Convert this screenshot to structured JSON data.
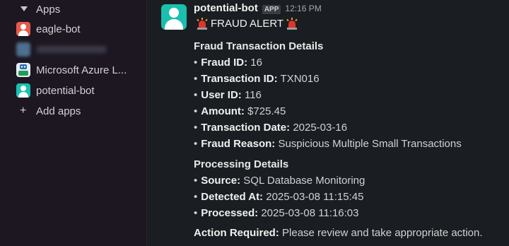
{
  "sidebar": {
    "section_label": "Apps",
    "items": [
      {
        "label": "eagle-bot",
        "avatar": "person-icon",
        "color": "#e8584a"
      },
      {
        "label": "",
        "avatar": "blurred-avatar",
        "color": "#4e6f8f"
      },
      {
        "label": "Microsoft Azure L...",
        "avatar": "azure-bot-icon",
        "color": "#e7eef7"
      },
      {
        "label": "potential-bot",
        "avatar": "person-icon",
        "color": "#18c1b0"
      }
    ],
    "add_label": "Add apps"
  },
  "message": {
    "author": "potential-bot",
    "badge": "APP",
    "time": "12:16 PM",
    "alert_icon": "rotating-light-icon",
    "alert_title": "FRAUD ALERT",
    "section1_title": "Fraud Transaction Details",
    "details": [
      {
        "key": "Fraud ID:",
        "value": "16"
      },
      {
        "key": "Transaction ID:",
        "value": "TXN016"
      },
      {
        "key": "User ID:",
        "value": "116"
      },
      {
        "key": "Amount:",
        "value": "$725.45"
      },
      {
        "key": "Transaction Date:",
        "value": "2025-03-16"
      },
      {
        "key": "Fraud Reason:",
        "value": "Suspicious Multiple Small Transactions"
      }
    ],
    "section2_title": "Processing Details",
    "processing": [
      {
        "key": "Source:",
        "value": "SQL Database Monitoring"
      },
      {
        "key": "Detected At:",
        "value": "2025-03-08 11:15:45"
      },
      {
        "key": "Processed:",
        "value": "2025-03-08 11:16:03"
      }
    ],
    "action_key": "Action Required:",
    "action_text": "Please review and take appropriate action."
  }
}
